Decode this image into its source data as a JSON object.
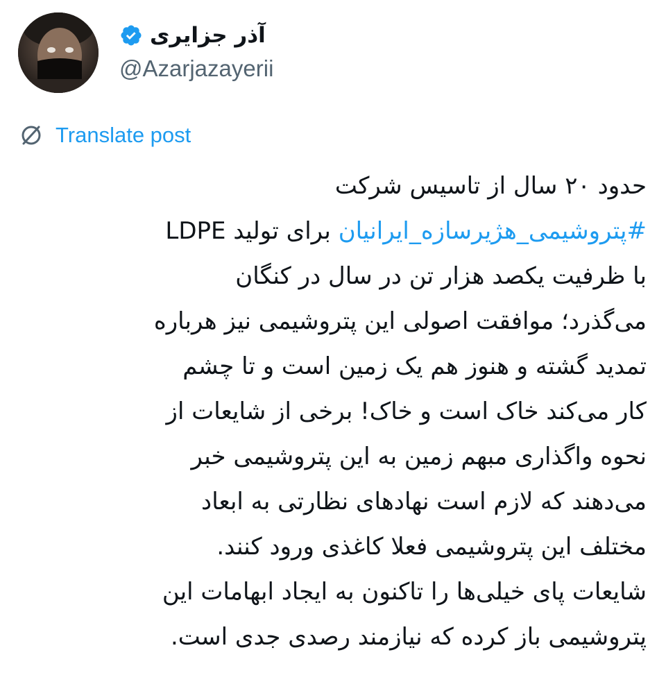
{
  "author": {
    "display_name": "آذر جزایری",
    "handle": "@Azarjazayerii",
    "verified": true,
    "verified_icon": "verified-badge-icon",
    "avatar_icon": "profile-photo"
  },
  "translate": {
    "icon": "translate-globe-icon",
    "label": "Translate post"
  },
  "post": {
    "lines": [
      "حدود ۲۰ سال از تاسیس شرکت",
      "#پتروشیمی_هژیرسازه_ایرانیان",
      "با ظرفیت یکصد هزار تن در سال در کنگان",
      "می‌گذرد؛ موافقت اصولی این پتروشیمی نیز هرباره",
      "تمدید گشته و هنوز هم یک زمین است و تا چشم",
      "کار می‌کند خاک است و خاک! برخی از شایعات از",
      "نحوه واگذاری مبهم زمین به این پتروشیمی خبر",
      "می‌دهند که لازم است نهادهای نظارتی به ابعاد",
      "مختلف این پتروشیمی فعلا کاغذی ورود کنند.",
      "شایعات پای خیلی‌ها را تاکنون به ایجاد ابهامات این",
      "پتروشیمی باز کرده که نیازمند رصدی جدی است."
    ],
    "line2_suffix": " برای تولید LDPE"
  },
  "colors": {
    "link": "#1d9bf0",
    "text": "#0f1419",
    "secondary": "#536471",
    "background": "#ffffff"
  }
}
